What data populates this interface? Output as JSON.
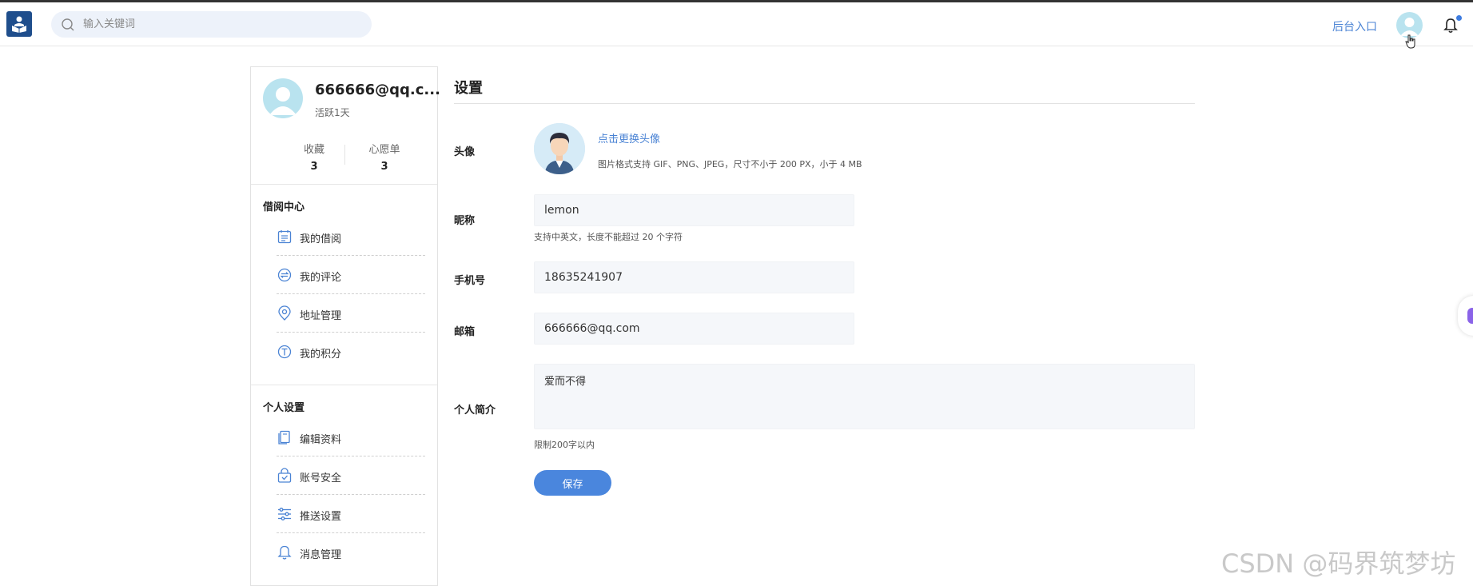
{
  "header": {
    "search_placeholder": "输入关键词",
    "admin_link": "后台入口"
  },
  "profile": {
    "name": "666666@qq.c...",
    "active": "活跃1天",
    "stats": [
      {
        "label": "收藏",
        "value": "3"
      },
      {
        "label": "心愿单",
        "value": "3"
      }
    ]
  },
  "sidebar": {
    "sections": [
      {
        "title": "借阅中心",
        "items": [
          {
            "label": "我的借阅",
            "icon": "calendar-icon"
          },
          {
            "label": "我的评论",
            "icon": "comment-icon"
          },
          {
            "label": "地址管理",
            "icon": "location-icon"
          },
          {
            "label": "我的积分",
            "icon": "points-icon"
          }
        ]
      },
      {
        "title": "个人设置",
        "items": [
          {
            "label": "编辑资料",
            "icon": "edit-profile-icon"
          },
          {
            "label": "账号安全",
            "icon": "security-icon"
          },
          {
            "label": "推送设置",
            "icon": "sliders-icon"
          },
          {
            "label": "消息管理",
            "icon": "bell-icon"
          }
        ]
      }
    ]
  },
  "settings": {
    "title": "设置",
    "avatar_label": "头像",
    "change_avatar": "点击更换头像",
    "avatar_hint": "图片格式支持 GIF、PNG、JPEG，尺寸不小于 200 PX，小于 4 MB",
    "nickname_label": "昵称",
    "nickname_value": "lemon",
    "nickname_hint": "支持中英文，长度不能超过 20 个字符",
    "phone_label": "手机号",
    "phone_value": "18635241907",
    "email_label": "邮箱",
    "email_value": "666666@qq.com",
    "bio_label": "个人简介",
    "bio_value": "爱而不得",
    "bio_hint": "限制200字以内",
    "save_label": "保存"
  },
  "watermark": "CSDN @码界筑梦坊",
  "colors": {
    "accent": "#4a86dd",
    "link": "#4a83d4",
    "logo": "#1f4e8c",
    "avatar_bg": "#b9e3ef"
  }
}
